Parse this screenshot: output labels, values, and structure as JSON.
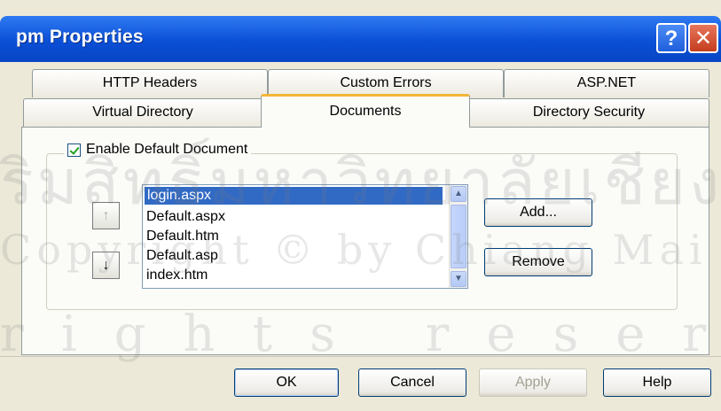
{
  "window": {
    "title": "pm Properties",
    "help_glyph": "?",
    "close_glyph": "✕"
  },
  "tabs": {
    "row1": [
      "HTTP Headers",
      "Custom Errors",
      "ASP.NET"
    ],
    "row2": [
      "Virtual Directory",
      "Documents",
      "Directory Security"
    ],
    "active": "Documents"
  },
  "documents": {
    "enable_default_label": "Enable Default Document",
    "enable_default_checked": true,
    "move_up_glyph": "↑",
    "move_down_glyph": "↓",
    "list_items": [
      "login.aspx",
      "Default.aspx",
      "Default.htm",
      "Default.asp",
      "index.htm"
    ],
    "selected_index": 0,
    "add_label": "Add...",
    "remove_label": "Remove"
  },
  "footer": {
    "ok_label": "OK",
    "cancel_label": "Cancel",
    "apply_label": "Apply",
    "help_label": "Help"
  },
  "watermark": {
    "line1": "ริมสิทธิ์มหาวิทยาลัยเชียงใหม่",
    "line2": "Copyright © by Chiang Mai University",
    "line3": "rights reserved"
  },
  "colors": {
    "titlebar": "#0a4fd6",
    "active_tab_accent": "#f3b639",
    "selection": "#316ac5"
  }
}
